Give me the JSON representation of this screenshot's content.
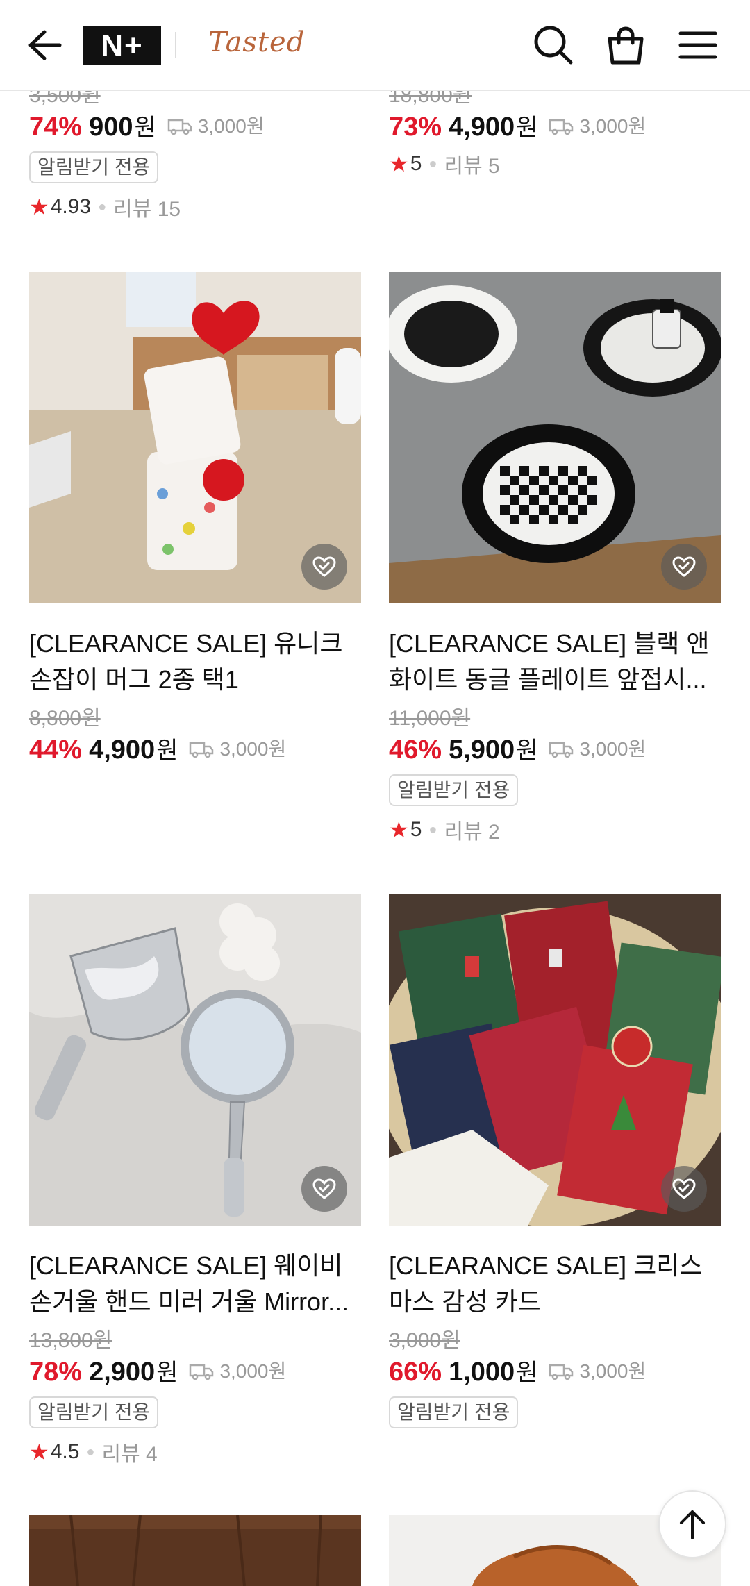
{
  "header": {
    "logo_text": "N+",
    "brand_name": "Tasted",
    "icons": [
      "back-arrow-icon",
      "search-icon",
      "shopping-bag-icon",
      "menu-icon"
    ]
  },
  "top_row": {
    "left": {
      "original_price": "3,500원",
      "discount": "74%",
      "price": "900",
      "currency": "원",
      "shipping": "3,000원",
      "badge": "알림받기 전용",
      "rating": "4.93",
      "review_label": "리뷰 15"
    },
    "right": {
      "original_price": "18,800원",
      "discount": "73%",
      "price": "4,900",
      "currency": "원",
      "shipping": "3,000원",
      "rating": "5",
      "review_label": "리뷰 5"
    }
  },
  "products": [
    {
      "title": "[CLEARANCE SALE] 유니크 손잡이 머그 2종 택1",
      "original_price": "8,800원",
      "discount": "44%",
      "price": "4,900",
      "currency": "원",
      "shipping": "3,000원"
    },
    {
      "title": "[CLEARANCE SALE] 블랙 앤 화이트 동글 플레이트 앞접시...",
      "original_price": "11,000원",
      "discount": "46%",
      "price": "5,900",
      "currency": "원",
      "shipping": "3,000원",
      "badge": "알림받기 전용",
      "rating": "5",
      "review_label": "리뷰 2"
    },
    {
      "title": "[CLEARANCE SALE] 웨이비 손거울 핸드 미러 거울 Mirror...",
      "original_price": "13,800원",
      "discount": "78%",
      "price": "2,900",
      "currency": "원",
      "shipping": "3,000원",
      "badge": "알림받기 전용",
      "rating": "4.5",
      "review_label": "리뷰 4"
    },
    {
      "title": "[CLEARANCE SALE] 크리스마스 감성 카드",
      "original_price": "3,000원",
      "discount": "66%",
      "price": "1,000",
      "currency": "원",
      "shipping": "3,000원",
      "badge": "알림받기 전용"
    }
  ],
  "colors": {
    "discount": "#e0192c",
    "star": "#e8262b",
    "brand": "#b9653b"
  }
}
